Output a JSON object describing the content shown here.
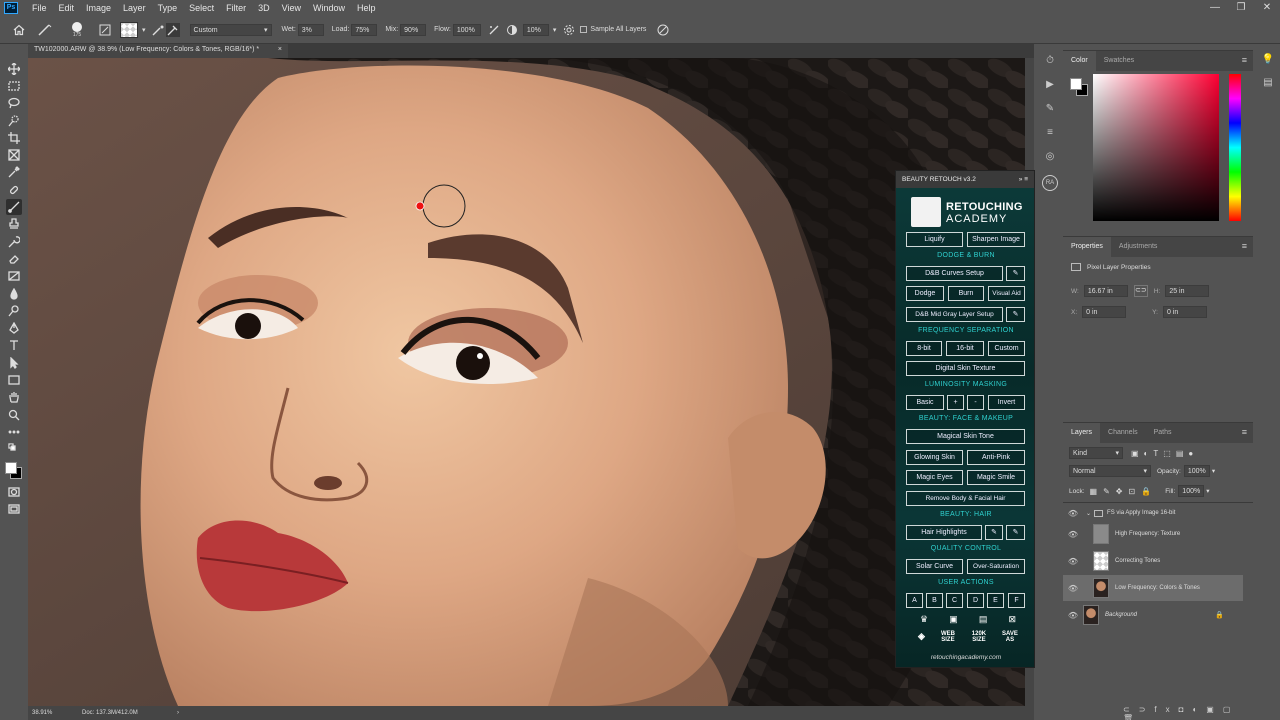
{
  "app": {
    "logo": "Ps"
  },
  "menu": [
    "File",
    "Edit",
    "Image",
    "Layer",
    "Type",
    "Select",
    "Filter",
    "3D",
    "View",
    "Window",
    "Help"
  ],
  "window_controls": [
    "—",
    "❐",
    "✕"
  ],
  "options": {
    "brush_size": "175",
    "mixer_preset": "Custom",
    "wet_label": "Wet:",
    "wet": "3%",
    "load_label": "Load:",
    "load": "75%",
    "mix_label": "Mix:",
    "mix": "90%",
    "flow_label": "Flow:",
    "flow": "100%",
    "smoothing": "10%",
    "sample_all_layers": "Sample All Layers"
  },
  "document": {
    "tab_title": "TW102000.ARW @ 38.9% (Low Frequency: Colors & Tones, RGB/16*) *",
    "close": "×"
  },
  "status": {
    "zoom": "38.91%",
    "doc": "Doc: 137.3M/412.0M",
    "arrow": "›"
  },
  "color_panel": {
    "tabs": [
      "Color",
      "Swatches"
    ]
  },
  "properties": {
    "tabs": [
      "Properties",
      "Adjustments"
    ],
    "title": "Pixel Layer Properties",
    "w_label": "W:",
    "w": "16.67 in",
    "h_label": "H:",
    "h": "25 in",
    "x_label": "X:",
    "x": "0 in",
    "y_label": "Y:",
    "y": "0 in"
  },
  "layers": {
    "tabs": [
      "Layers",
      "Channels",
      "Paths"
    ],
    "filter": "Kind",
    "blend": "Normal",
    "opacity_label": "Opacity:",
    "opacity": "100%",
    "lock_label": "Lock:",
    "fill_label": "Fill:",
    "fill": "100%",
    "items": [
      {
        "name": "FS via Apply Image 16-bit",
        "type": "group"
      },
      {
        "name": "High Frequency: Texture",
        "type": "gray"
      },
      {
        "name": "Correcting Tones",
        "type": "transparent"
      },
      {
        "name": "Low Frequency: Colors & Tones",
        "type": "face",
        "selected": true
      },
      {
        "name": "Background",
        "type": "face",
        "locked": true
      }
    ]
  },
  "beauty": {
    "title": "BEAUTY RETOUCH v3.2",
    "logo_line1": "RETOUCHING",
    "logo_line2": "ACADEMY",
    "liquify": "Liquify",
    "sharpen": "Sharpen Image",
    "sec_dodge": "DODGE & BURN",
    "db_curves": "D&B Curves Setup",
    "dodge": "Dodge",
    "burn": "Burn",
    "visual_aid": "Visual Aid",
    "db_midgray": "D&B Mid Gray Layer Setup",
    "sec_freq": "FREQUENCY SEPARATION",
    "bit8": "8-bit",
    "bit16": "16-bit",
    "custom": "Custom",
    "digital_skin": "Digital Skin Texture",
    "sec_lum": "LUMINOSITY MASKING",
    "basic": "Basic",
    "plus": "+",
    "minus": "-",
    "invert": "Invert",
    "sec_face": "BEAUTY: FACE & MAKEUP",
    "magical_tone": "Magical Skin Tone",
    "glowing": "Glowing Skin",
    "antipink": "Anti-Pink",
    "magic_eyes": "Magic Eyes",
    "magic_smile": "Magic Smile",
    "remove_hair": "Remove Body & Facial Hair",
    "sec_hair": "BEAUTY: HAIR",
    "hair_highlights": "Hair Highlights",
    "sec_quality": "QUALITY CONTROL",
    "solar": "Solar Curve",
    "oversat": "Over-Saturation",
    "sec_user": "USER ACTIONS",
    "user_actions": [
      "A",
      "B",
      "C",
      "D",
      "E",
      "F"
    ],
    "web_size": "WEB SIZE",
    "size_120k": "120K SIZE",
    "save_as": "SAVE AS",
    "url": "retouchingacademy.com"
  },
  "colors": {
    "accent": "#2fd1cf",
    "brush_dot": "#e11",
    "panel_bg": "#535353"
  }
}
